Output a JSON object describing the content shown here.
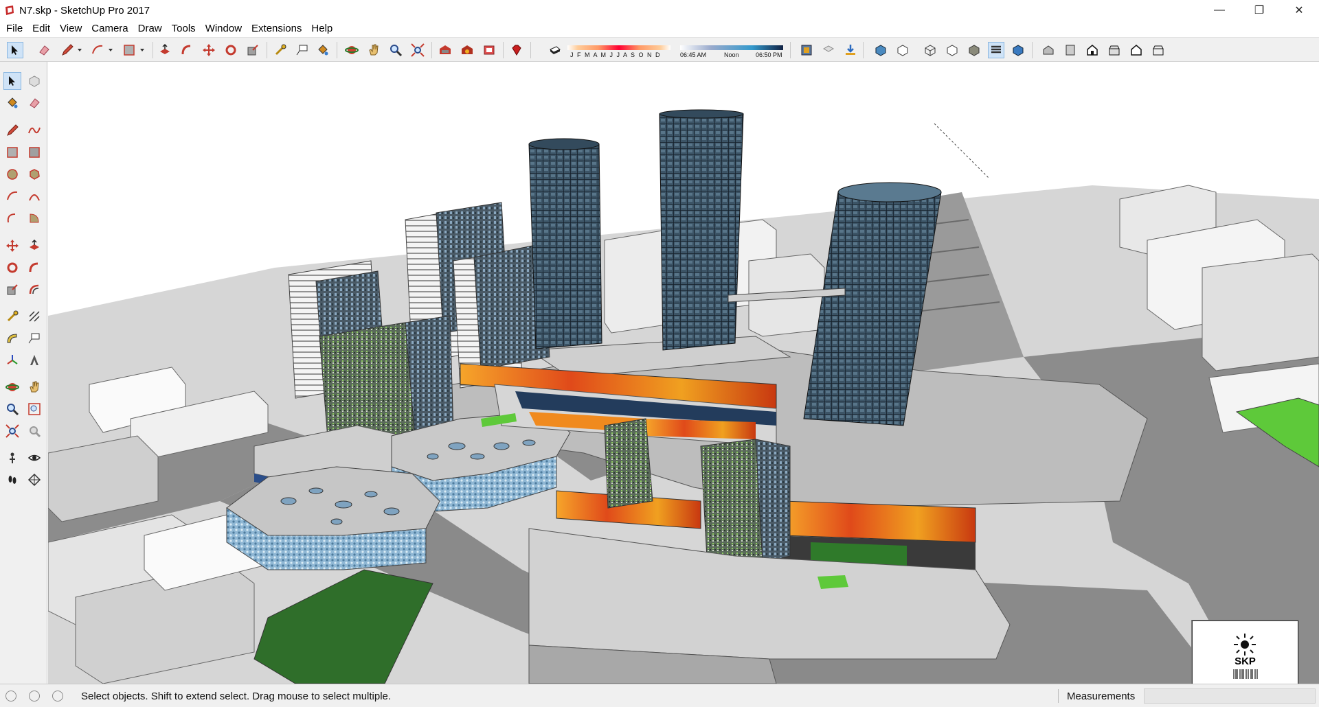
{
  "window": {
    "title": "N7.skp - SketchUp Pro 2017",
    "minimize": "—",
    "maximize": "❐",
    "close": "✕"
  },
  "menu": [
    "File",
    "Edit",
    "View",
    "Camera",
    "Draw",
    "Tools",
    "Window",
    "Extensions",
    "Help"
  ],
  "shadow_settings": {
    "months": "J F M A M J J A S O N D",
    "time_start": "06:45 AM",
    "time_mid": "Noon",
    "time_end": "06:50 PM"
  },
  "status": {
    "message": "Select objects. Shift to extend select. Drag mouse to select multiple.",
    "measurements_label": "Measurements",
    "measurements_value": ""
  },
  "thumbnail": {
    "label": "SKP"
  },
  "colors": {
    "ground": "#8a8a8a",
    "building": "#d8d8d8",
    "glass_tower": "#3e5668",
    "banner_orange": "#f08a1e",
    "green": "#2f8a2a",
    "bright_green": "#5ec93a"
  }
}
